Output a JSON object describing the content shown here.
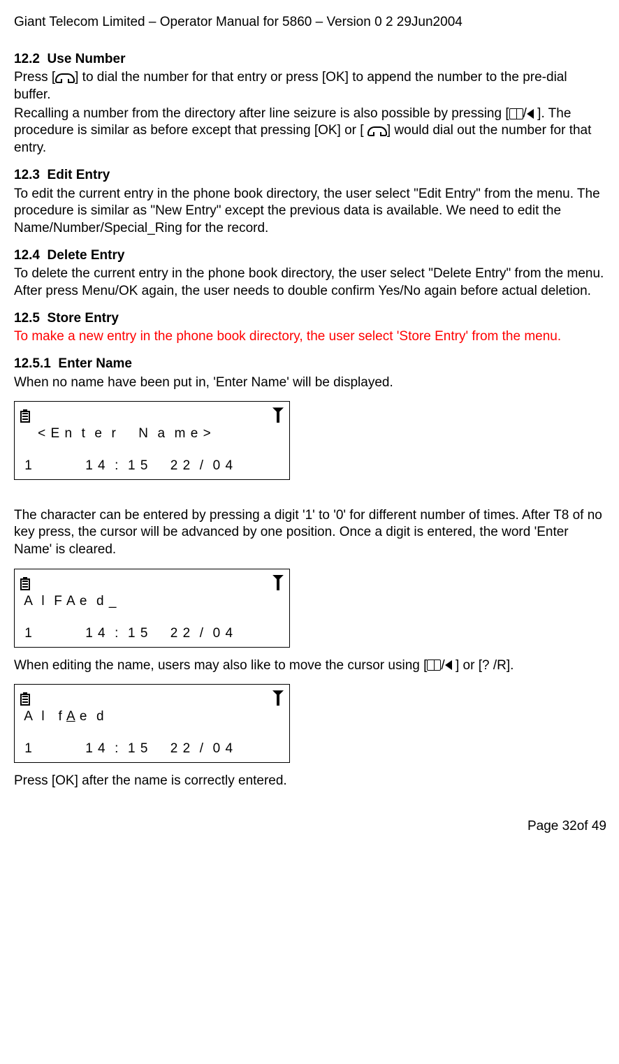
{
  "header": "Giant Telecom Limited – Operator Manual for 5860 – Version 0 2 29Jun2004",
  "sections": {
    "s122": {
      "num": "12.2",
      "title": "Use Number",
      "p1a": "Press [",
      "p1b": "] to dial the number for that entry or press [OK] to append the number to the pre-dial buffer.",
      "p2a": "Recalling a number from the directory after line seizure is also possible by pressing [",
      "p2b": "/",
      "p2c": " ]. The procedure is similar as before except that pressing [OK] or [ ",
      "p2d": "] would dial out the number for that entry."
    },
    "s123": {
      "num": "12.3",
      "title": "Edit Entry",
      "p1": "To edit the current entry in the phone book directory, the user select \"Edit Entry\" from the menu. The procedure is similar as \"New Entry\" except the previous data is available. We need to edit the Name/Number/Special_Ring for the record."
    },
    "s124": {
      "num": "12.4",
      "title": "Delete Entry",
      "p1": "To delete the current entry in the phone book directory, the user select \"Delete Entry\" from the menu. After press Menu/OK again, the user needs to double confirm Yes/No again before actual deletion."
    },
    "s125": {
      "num": "12.5",
      "title": "Store Entry",
      "p1": "To make a new entry in the phone book directory, the user select 'Store Entry' from the menu."
    },
    "s1251": {
      "num": "12.5.1",
      "title": "Enter Name",
      "p1": "When no name have been put in, 'Enter Name' will be displayed.",
      "p2": "The character can be entered by pressing a digit '1' to '0' for different number of times.  After T8 of no key press, the cursor will be advanced by one position. Once a digit is entered, the word 'Enter Name' is cleared.",
      "p3a": "When editing the name, users may also like to move the cursor using  [",
      "p3b": "/",
      "p3c": " ] or [? /R].",
      "p4": "Press [OK] after the name is correctly entered."
    }
  },
  "lcd1": {
    "line1": "    < E n  t  e  r     N  a  m e >",
    "status": " 1            1 4  :  1 5     2 2  /  0 4"
  },
  "lcd2": {
    "line1": " A  l  F A e  d _",
    "status": " 1            1 4  :  1 5     2 2  /  0 4"
  },
  "lcd3": {
    "line1a": " A  l   f ",
    "line1u": "A",
    "line1b": " e  d",
    "status": " 1            1 4  :  1 5     2 2  /  0 4"
  },
  "footer": "Page 32of 49"
}
